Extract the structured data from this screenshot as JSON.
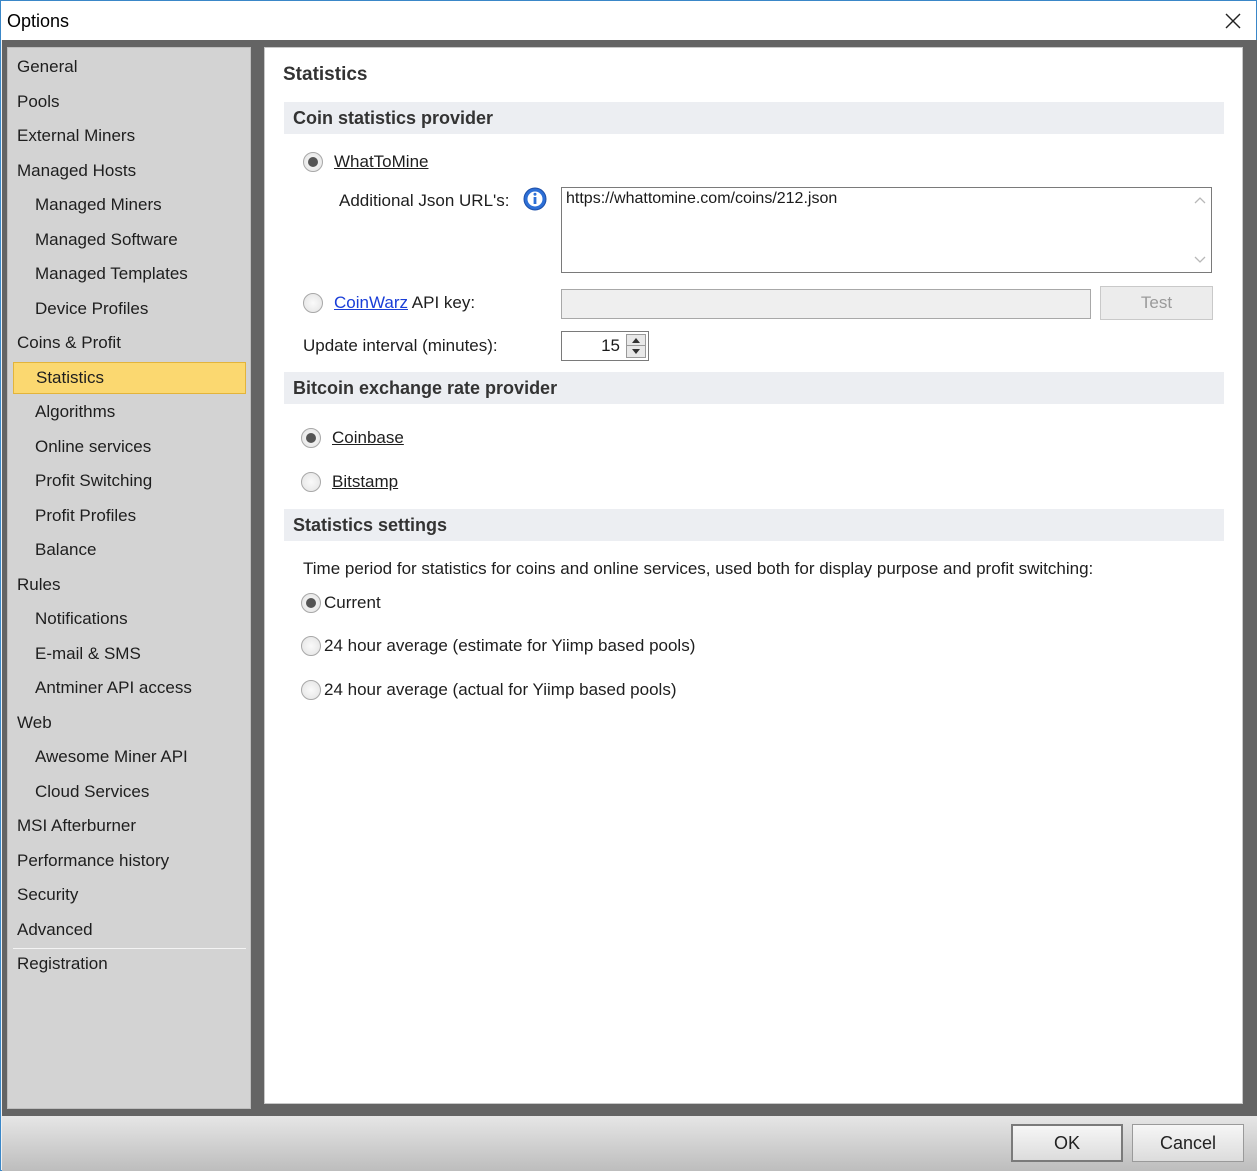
{
  "window": {
    "title": "Options"
  },
  "sidebar": {
    "items": [
      {
        "label": "General",
        "level": 0
      },
      {
        "label": "Pools",
        "level": 0
      },
      {
        "label": "External Miners",
        "level": 0
      },
      {
        "label": "Managed Hosts",
        "level": 0
      },
      {
        "label": "Managed Miners",
        "level": 1
      },
      {
        "label": "Managed Software",
        "level": 1
      },
      {
        "label": "Managed Templates",
        "level": 1
      },
      {
        "label": "Device Profiles",
        "level": 1
      },
      {
        "label": "Coins & Profit",
        "level": 0
      },
      {
        "label": "Statistics",
        "level": 1,
        "selected": true
      },
      {
        "label": "Algorithms",
        "level": 1
      },
      {
        "label": "Online services",
        "level": 1
      },
      {
        "label": "Profit Switching",
        "level": 1
      },
      {
        "label": "Profit Profiles",
        "level": 1
      },
      {
        "label": "Balance",
        "level": 1
      },
      {
        "label": "Rules",
        "level": 0
      },
      {
        "label": "Notifications",
        "level": 1
      },
      {
        "label": "E-mail & SMS",
        "level": 1
      },
      {
        "label": "Antminer API access",
        "level": 1
      },
      {
        "label": "Web",
        "level": 0
      },
      {
        "label": "Awesome Miner API",
        "level": 1
      },
      {
        "label": "Cloud Services",
        "level": 1
      },
      {
        "label": "MSI Afterburner",
        "level": 0
      },
      {
        "label": "Performance history",
        "level": 0
      },
      {
        "label": "Security",
        "level": 0
      },
      {
        "label": "Advanced",
        "level": 0
      },
      {
        "label": "Registration",
        "level": 0
      }
    ]
  },
  "content": {
    "title": "Statistics",
    "coin_section": {
      "header": "Coin statistics provider",
      "whattomine_label": "WhatToMine",
      "whattomine_selected": true,
      "json_urls_label": "Additional Json URL's:",
      "json_urls_value": "https://whattomine.com/coins/212.json",
      "coinwarz_label": "CoinWarz",
      "coinwarz_selected": false,
      "api_key_label": "API key:",
      "api_key_value": "",
      "test_button": "Test",
      "update_interval_label": "Update interval (minutes):",
      "update_interval_value": "15"
    },
    "bitcoin_section": {
      "header": "Bitcoin exchange rate provider",
      "options": [
        {
          "label": "Coinbase",
          "selected": true
        },
        {
          "label": "Bitstamp",
          "selected": false
        }
      ]
    },
    "stats_section": {
      "header": "Statistics settings",
      "description": "Time period for statistics for coins and online services, used both for display purpose and profit switching:",
      "options": [
        {
          "label": "Current",
          "selected": true
        },
        {
          "label": "24 hour average (estimate for Yiimp based pools)",
          "selected": false
        },
        {
          "label": "24 hour average (actual for Yiimp based pools)",
          "selected": false
        }
      ]
    }
  },
  "footer": {
    "ok_label": "OK",
    "cancel_label": "Cancel"
  },
  "colors": {
    "selected_item": "#fbd870",
    "link": "#1a3ed8",
    "frame": "#646464"
  }
}
